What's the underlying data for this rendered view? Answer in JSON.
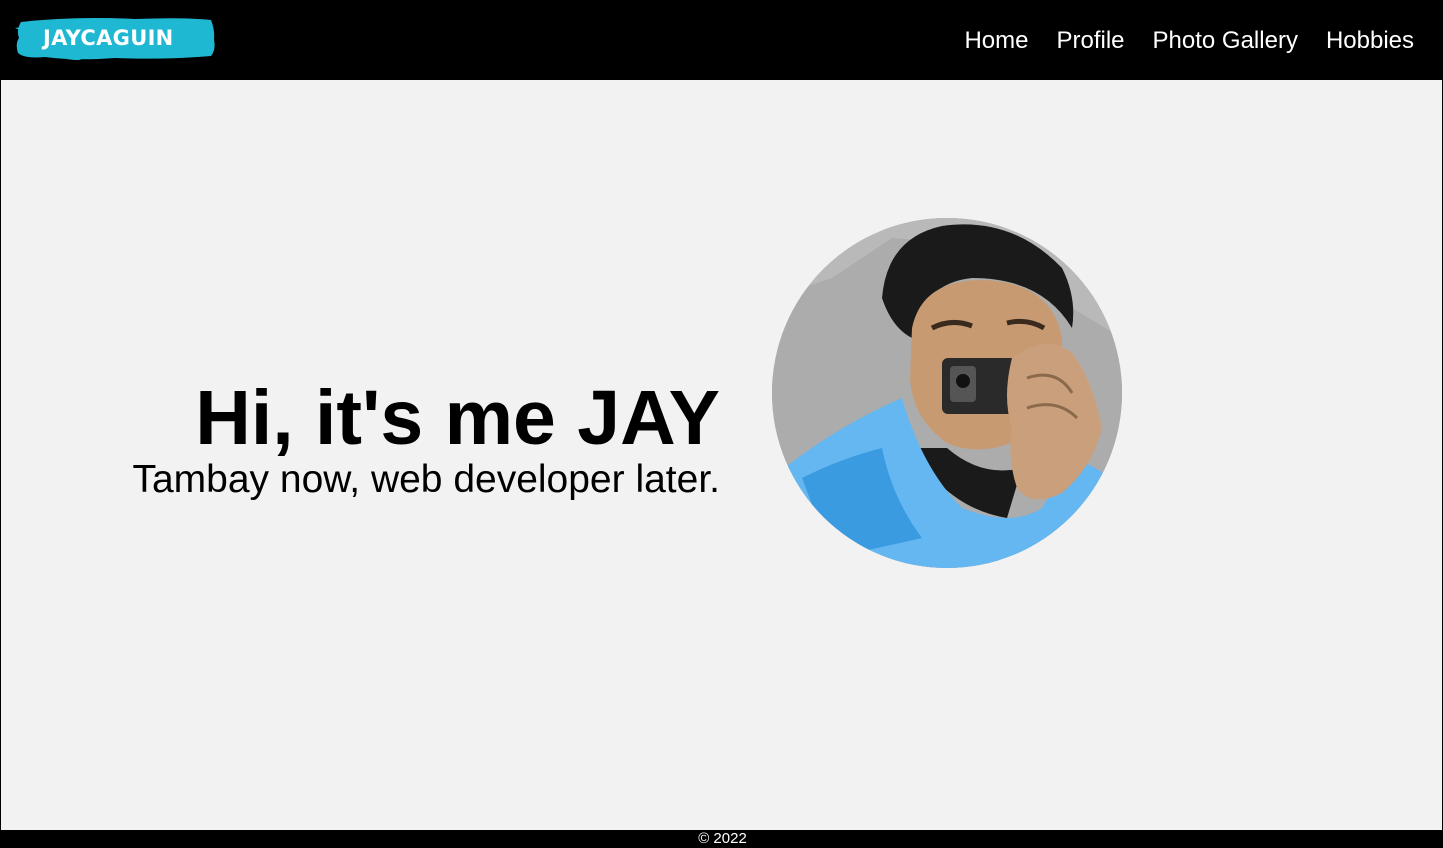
{
  "brand": {
    "logo_text": "JAYCAGUIN",
    "accent": "#1fb8d3"
  },
  "nav": {
    "items": [
      {
        "label": "Home"
      },
      {
        "label": "Profile"
      },
      {
        "label": "Photo Gallery"
      },
      {
        "label": "Hobbies"
      }
    ]
  },
  "hero": {
    "title": "Hi, it's me JAY",
    "subtitle": "Tambay now, web developer later."
  },
  "footer": {
    "copyright": "© 2022"
  },
  "colors": {
    "navbar": "#000000",
    "background": "#f2f2f2",
    "text": "#000000"
  }
}
